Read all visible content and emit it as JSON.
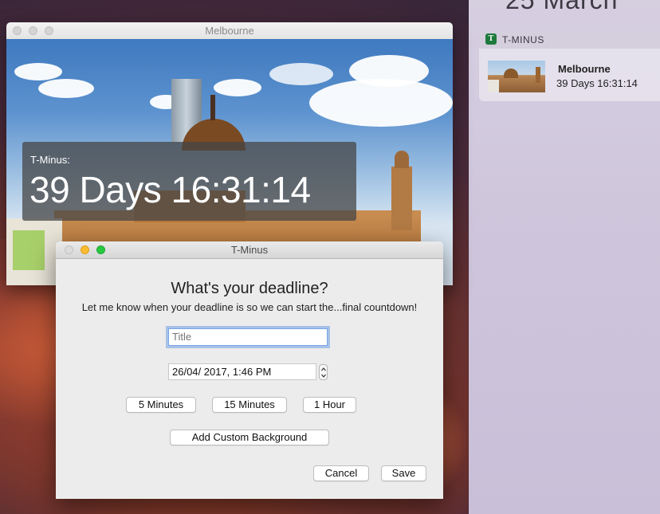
{
  "desktop": {
    "notification_center": {
      "date_partial": "25   March",
      "app_name": "T-MINUS",
      "app_icon_letter": "T",
      "notification_title": "Melbourne",
      "notification_body": "39 Days 16:31:14"
    }
  },
  "melbourne_window": {
    "title": "Melbourne",
    "overlay_label": "T-Minus:",
    "countdown": "39 Days 16:31:14"
  },
  "dialog": {
    "title": "T-Minus",
    "heading": "What's your deadline?",
    "subheading": "Let me know when your deadline is so we can start the...final countdown!",
    "title_field": {
      "value": "",
      "placeholder": "Title"
    },
    "date_field_value": "26/04/ 2017,   1:46 PM",
    "preset_buttons": [
      "5 Minutes",
      "15 Minutes",
      "1 Hour"
    ],
    "custom_background_label": "Add Custom Background",
    "cancel_label": "Cancel",
    "save_label": "Save"
  },
  "colors": {
    "traffic_red_inactive": "#dcdcdc",
    "traffic_yellow": "#fdbb2f",
    "traffic_green": "#28c840",
    "focus_ring": "#7aa7e6",
    "app_icon_green": "#1e7a3c"
  }
}
